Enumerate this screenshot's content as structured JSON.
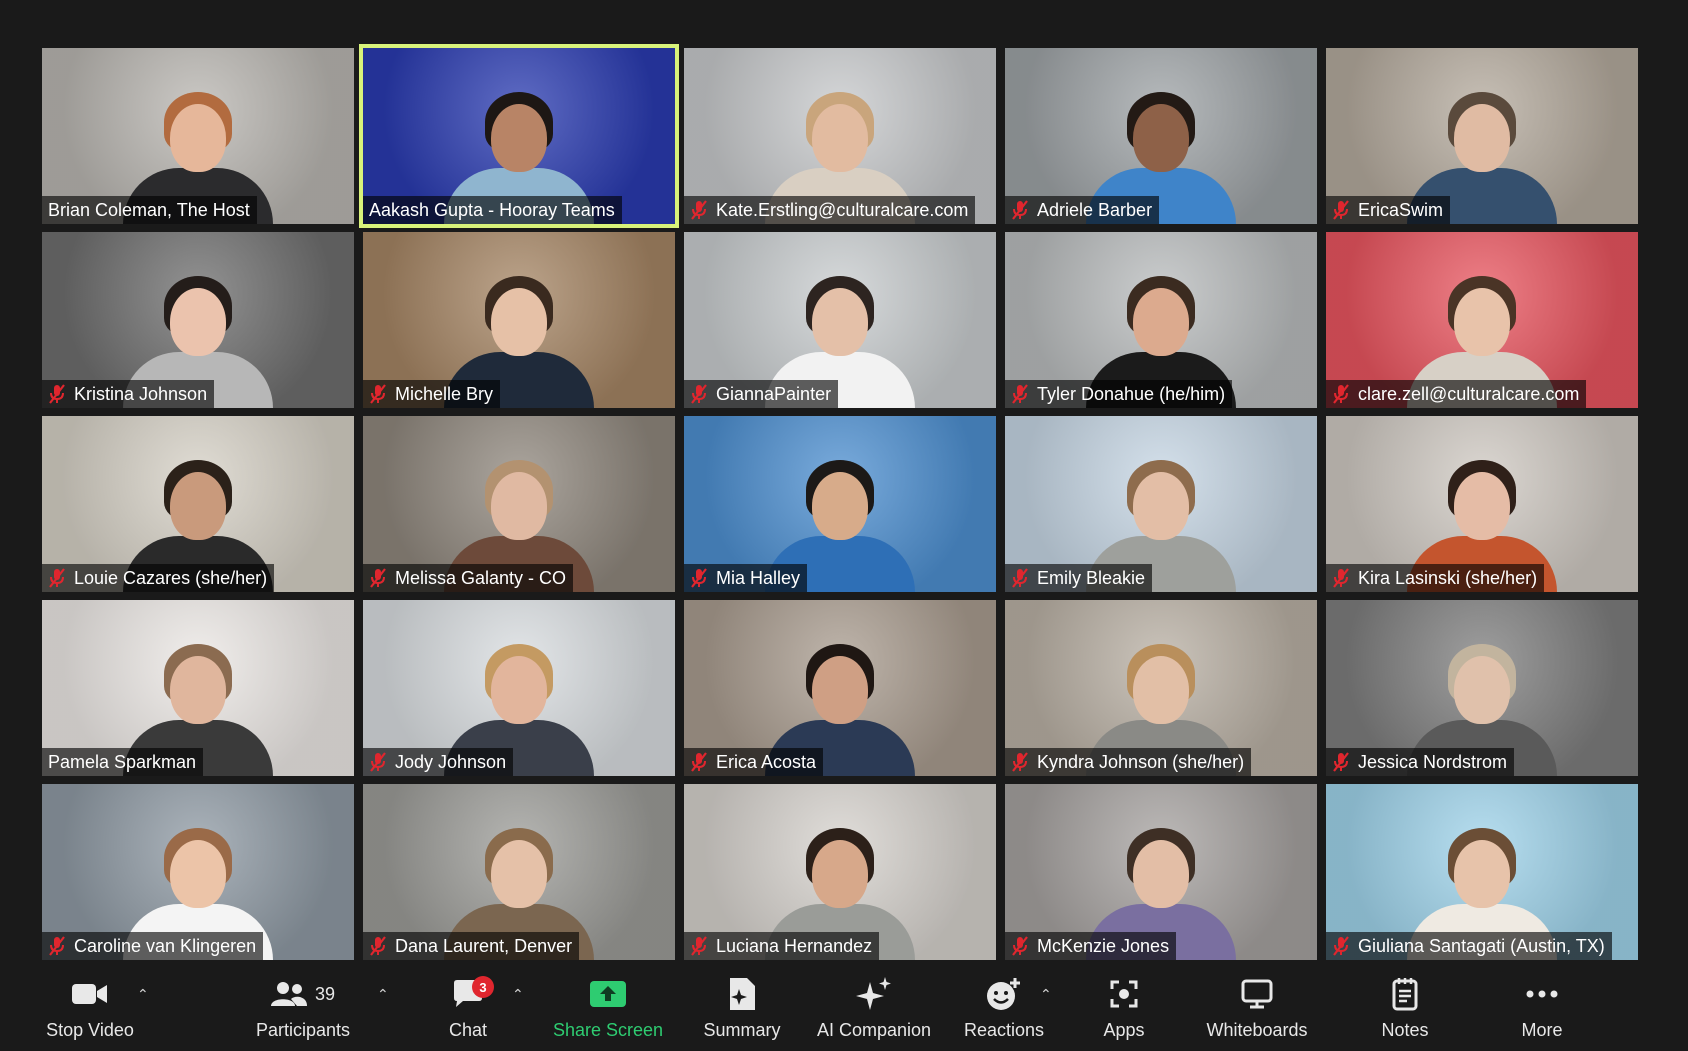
{
  "participants": [
    {
      "name": "Brian Coleman, The Host",
      "muted": false,
      "active": false,
      "bg": "#b9b6b1",
      "skin": "#e6b79a",
      "hair": "#b26b3f",
      "shirt": "#2b2b2d"
    },
    {
      "name": "Aakash Gupta - Hooray Teams",
      "muted": false,
      "active": true,
      "bg": "#2a3bb0",
      "skin": "#b88466",
      "hair": "#1d1714",
      "shirt": "#8fb5cf"
    },
    {
      "name": "Kate.Erstling@culturalcare.com",
      "muted": true,
      "active": false,
      "bg": "#c7c9cb",
      "skin": "#e2bba0",
      "hair": "#c9a57c",
      "shirt": "#d9cfc2"
    },
    {
      "name": "Adriele Barber",
      "muted": true,
      "active": false,
      "bg": "#9ea3a6",
      "skin": "#8e6148",
      "hair": "#231a15",
      "shirt": "#3f84c9"
    },
    {
      "name": "EricaSwim",
      "muted": true,
      "active": false,
      "bg": "#b4aa9d",
      "skin": "#e0bba3",
      "hair": "#5a4a3c",
      "shirt": "#35506e"
    },
    {
      "name": "Kristina Johnson",
      "muted": true,
      "active": false,
      "bg": "#6e6e6e",
      "skin": "#ebc3ad",
      "hair": "#241d1a",
      "shirt": "#b7b7b7"
    },
    {
      "name": "Michelle Bry",
      "muted": true,
      "active": false,
      "bg": "#a58564",
      "skin": "#e6c1a7",
      "hair": "#3a2a1f",
      "shirt": "#1f2a3a"
    },
    {
      "name": "GiannaPainter",
      "muted": true,
      "active": false,
      "bg": "#c9cdcf",
      "skin": "#e4c0a8",
      "hair": "#2d2420",
      "shirt": "#f2f2f2"
    },
    {
      "name": "Tyler Donahue (he/him)",
      "muted": true,
      "active": false,
      "bg": "#b9bcbd",
      "skin": "#dcaa8e",
      "hair": "#3b2b20",
      "shirt": "#1b1b1b"
    },
    {
      "name": "clare.zell@culturalcare.com",
      "muted": true,
      "active": false,
      "bg": "#e8555f",
      "skin": "#e8c3aa",
      "hair": "#4a3426",
      "shirt": "#d7d0c6"
    },
    {
      "name": "Louie Cazares (she/her)",
      "muted": true,
      "active": false,
      "bg": "#d6d1c6",
      "skin": "#c99a7c",
      "hair": "#2b2119",
      "shirt": "#2a2a2a"
    },
    {
      "name": "Melissa Galanty - CO",
      "muted": true,
      "active": false,
      "bg": "#8f877d",
      "skin": "#e0b9a2",
      "hair": "#b39270",
      "shirt": "#6d4a3a"
    },
    {
      "name": "Mia Halley",
      "muted": true,
      "active": false,
      "bg": "#4d8fd0",
      "skin": "#d7ab8a",
      "hair": "#1c1917",
      "shirt": "#2e6fb6"
    },
    {
      "name": "Emily Bleakie",
      "muted": true,
      "active": false,
      "bg": "#c6d6e4",
      "skin": "#e3bea6",
      "hair": "#8e6c4d",
      "shirt": "#9ea09c"
    },
    {
      "name": "Kira Lasinski (she/her)",
      "muted": true,
      "active": false,
      "bg": "#cfc9c2",
      "skin": "#e5bca6",
      "hair": "#2f2019",
      "shirt": "#c4552e"
    },
    {
      "name": "Pamela Sparkman",
      "muted": false,
      "active": false,
      "bg": "#ece8e5",
      "skin": "#e0b69d",
      "hair": "#8b6b50",
      "shirt": "#3a3a3a"
    },
    {
      "name": "Jody Johnson",
      "muted": true,
      "active": false,
      "bg": "#d9dde0",
      "skin": "#e2b59c",
      "hair": "#c49a62",
      "shirt": "#3a3f4a"
    },
    {
      "name": "Erica Acosta",
      "muted": true,
      "active": false,
      "bg": "#a99c8f",
      "skin": "#cf9f84",
      "hair": "#1f1713",
      "shirt": "#2b3a55"
    },
    {
      "name": "Kyndra Johnson (she/her)",
      "muted": true,
      "active": false,
      "bg": "#b9b0a4",
      "skin": "#e2bfa6",
      "hair": "#b98f5c",
      "shirt": "#8a8a86"
    },
    {
      "name": "Jessica Nordstrom",
      "muted": true,
      "active": false,
      "bg": "#7e7e7e",
      "skin": "#e0c1ab",
      "hair": "#c2b49e",
      "shirt": "#5a5a5a"
    },
    {
      "name": "Caroline van Klingeren",
      "muted": true,
      "active": false,
      "bg": "#8f9aa4",
      "skin": "#ecc4a8",
      "hair": "#9a6a48",
      "shirt": "#f4f4f4"
    },
    {
      "name": "Dana Laurent, Denver",
      "muted": true,
      "active": false,
      "bg": "#9c9c98",
      "skin": "#e5c1a8",
      "hair": "#8a6b4c",
      "shirt": "#7b6650"
    },
    {
      "name": "Luciana Hernandez",
      "muted": true,
      "active": false,
      "bg": "#d6d2cd",
      "skin": "#d7a88a",
      "hair": "#2c2019",
      "shirt": "#9a9c98"
    },
    {
      "name": "McKenzie Jones",
      "muted": true,
      "active": false,
      "bg": "#a6a2a0",
      "skin": "#e3bea6",
      "hair": "#3e2f25",
      "shirt": "#7a6fa0"
    },
    {
      "name": "Giuliana Santagati (Austin, TX)",
      "muted": true,
      "active": false,
      "bg": "#9fd3ea",
      "skin": "#e7c3aa",
      "hair": "#6b4e36",
      "shirt": "#efeae2"
    }
  ],
  "toolbar": {
    "stop_video": "Stop Video",
    "participants": "Participants",
    "participants_count": "39",
    "chat": "Chat",
    "chat_badge": "3",
    "share_screen": "Share Screen",
    "summary": "Summary",
    "ai_companion": "AI Companion",
    "reactions": "Reactions",
    "apps": "Apps",
    "whiteboards": "Whiteboards",
    "notes": "Notes",
    "more": "More"
  },
  "colors": {
    "background": "#1a1a1a",
    "active_speaker_border": "#d8f27a",
    "muted_icon": "#e0262e",
    "share_screen": "#2ecc71",
    "chat_badge": "#e0262e"
  }
}
